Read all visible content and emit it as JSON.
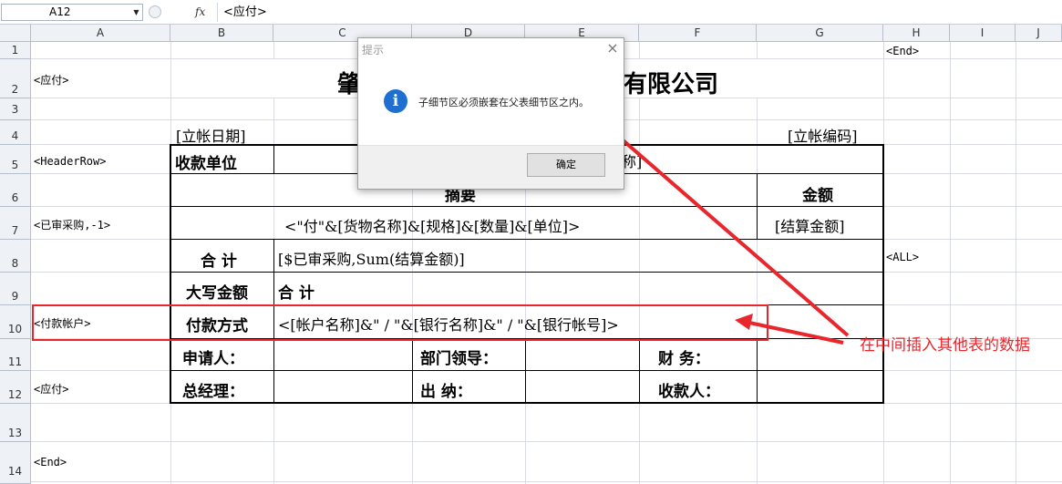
{
  "formula_bar": {
    "name_box": "A12",
    "fx_label": "fx",
    "formula": "<应付>"
  },
  "columns": [
    "A",
    "B",
    "C",
    "D",
    "E",
    "F",
    "G",
    "H",
    "I",
    "J"
  ],
  "rows": [
    "1",
    "2",
    "3",
    "4",
    "5",
    "6",
    "7",
    "8",
    "9",
    "10",
    "11",
    "12",
    "13",
    "14"
  ],
  "cells": {
    "h1": "<End>",
    "a2": "<应付>",
    "title_left": "肇",
    "title_right": "有限公司",
    "b4": "[立帐日期]",
    "g4": "[立帐编码]",
    "a5": "<HeaderRow>",
    "b5": "收款单位",
    "d5_partial": "称]",
    "summary_header": "摘要",
    "amount_header": "金额",
    "a7": "<已审采购,-1>",
    "row7_formula": "<\"付\"&[货物名称]&[规格]&[数量]&[单位]>",
    "row7_amount": "[结算金额]",
    "b8": "合 计",
    "c8": "[$已审采购,Sum(结算金额)]",
    "h8": "<ALL>",
    "b9": "大写金额",
    "c9": "合 计",
    "a10": "<付款帐户>",
    "b10": "付款方式",
    "c10": "<[帐户名称]&\" / \"&[银行名称]&\" / \"&[银行帐号]>",
    "b11": "申请人：",
    "d11": "部门领导：",
    "f11": "财 务：",
    "a12": "<应付>",
    "b12": "总经理：",
    "d12": "出 纳：",
    "f12": "收款人：",
    "a14": "<End>"
  },
  "dialog": {
    "title": "提示",
    "message": "子细节区必须嵌套在父表细节区之内。",
    "ok_label": "确定",
    "close_glyph": "×",
    "info_glyph": "i"
  },
  "annotation": {
    "text": "在中间插入其他表的数据",
    "color": "#e8262c"
  }
}
